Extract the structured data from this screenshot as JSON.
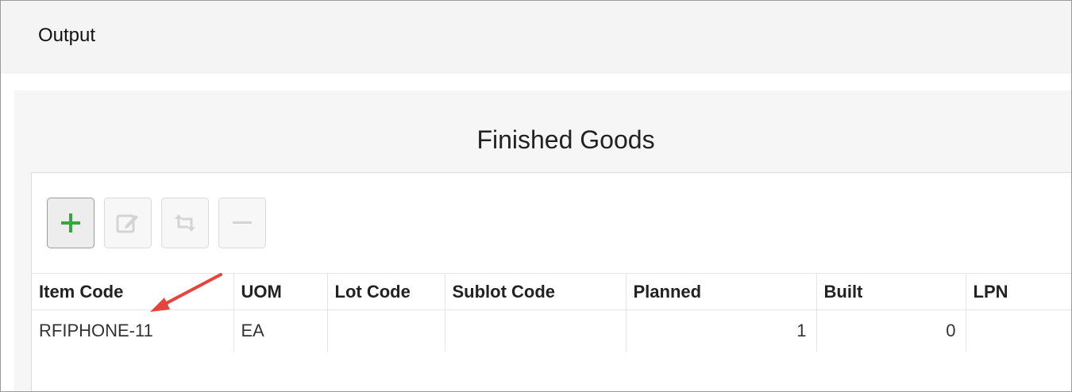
{
  "header": {
    "title": "Output"
  },
  "panel": {
    "title": "Finished Goods",
    "toolbar": [
      {
        "name": "add-button",
        "icon": "plus-icon",
        "enabled": true
      },
      {
        "name": "edit-button",
        "icon": "edit-icon",
        "enabled": false
      },
      {
        "name": "swap-button",
        "icon": "swap-icon",
        "enabled": false
      },
      {
        "name": "remove-button",
        "icon": "minus-icon",
        "enabled": false
      }
    ],
    "table": {
      "columns": [
        "Item Code",
        "UOM",
        "Lot Code",
        "Sublot Code",
        "Planned",
        "Built",
        "LPN"
      ],
      "rows": [
        [
          "RFIPHONE-11",
          "EA",
          "",
          "",
          "1",
          "0",
          ""
        ]
      ]
    }
  },
  "colors": {
    "accent_plus": "#3aa53a",
    "arrow": "#e8433d"
  }
}
